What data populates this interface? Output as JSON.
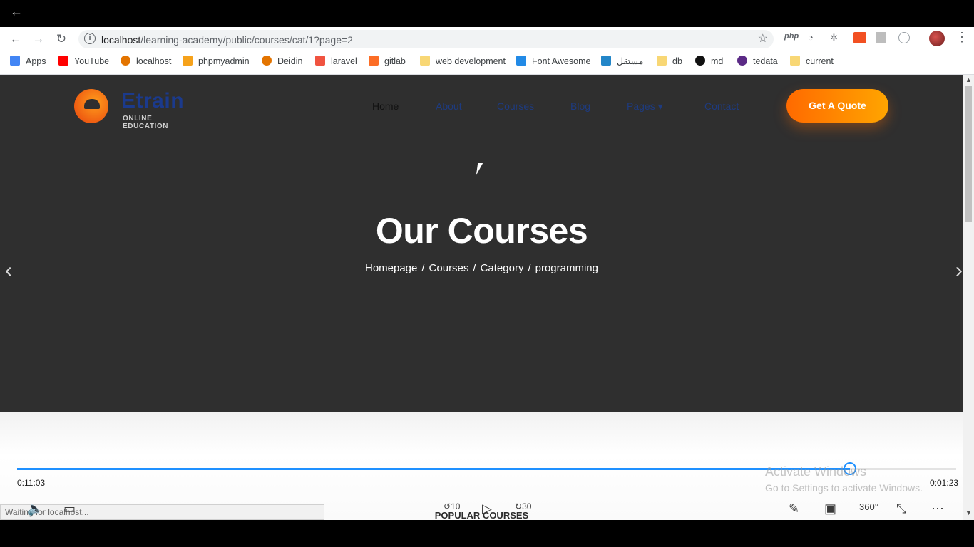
{
  "app": {
    "back_glyph": "←"
  },
  "browser": {
    "url_host": "localhost",
    "url_path": "/learning-academy/public/courses/cat/1?page=2",
    "bookmarks": [
      {
        "label": "Apps",
        "icon": "apps-grid-icon",
        "color": "#4285f4"
      },
      {
        "label": "YouTube",
        "icon": "youtube-icon",
        "color": "#ff0000"
      },
      {
        "label": "localhost",
        "icon": "localhost-icon",
        "color": "#e37400"
      },
      {
        "label": "phpmyadmin",
        "icon": "phpmyadmin-icon",
        "color": "#f6a21b"
      },
      {
        "label": "Deidin",
        "icon": "deidin-icon",
        "color": "#e37400"
      },
      {
        "label": "laravel",
        "icon": "laravel-icon",
        "color": "#f05340"
      },
      {
        "label": "gitlab",
        "icon": "gitlab-icon",
        "color": "#fc6d26"
      },
      {
        "label": "web development",
        "icon": "folder-icon",
        "color": "#f8d775"
      },
      {
        "label": "Font Awesome",
        "icon": "fontawesome-icon",
        "color": "#228ae6"
      },
      {
        "label": "مستقل",
        "icon": "mostaql-icon",
        "color": "#2386c8"
      },
      {
        "label": "db",
        "icon": "folder-icon",
        "color": "#f8d775"
      },
      {
        "label": "md",
        "icon": "github-icon",
        "color": "#111111"
      },
      {
        "label": "tedata",
        "icon": "tedata-icon",
        "color": "#5b2a86"
      },
      {
        "label": "current",
        "icon": "folder-icon",
        "color": "#f8d775"
      }
    ],
    "ext_php": "php"
  },
  "site": {
    "logo_name": "Etrain",
    "logo_sub": "ONLINE EDUCATION",
    "menu": [
      "Home",
      "About",
      "Courses",
      "Blog",
      "Pages ▾",
      "Contact"
    ],
    "quote_button": "Get A Quote",
    "hero_title": "Our Courses",
    "breadcrumb": [
      "Homepage",
      "Courses",
      "Category",
      "programming"
    ],
    "breadcrumb_sep": "/",
    "popular_label": "POPULAR COURSES"
  },
  "player": {
    "elapsed": "0:11:03",
    "remaining": "0:01:23",
    "progress": 0.887,
    "rewind_label": "10",
    "forward_label": "30",
    "status_text": "Waiting for localhost..."
  },
  "watermark": {
    "title": "Activate Windows",
    "subtitle": "Go to Settings to activate Windows."
  },
  "colors": {
    "accent": "#1e90ff",
    "quote": "#ff7a00",
    "hero_bg": "#2f2f2f"
  }
}
